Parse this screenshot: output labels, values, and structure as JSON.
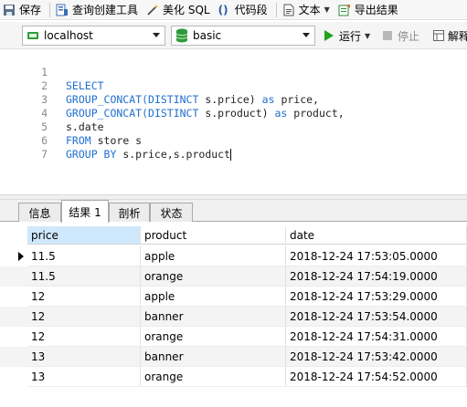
{
  "toolbar": {
    "save": "保存",
    "query_builder": "查询创建工具",
    "beautify": "美化 SQL",
    "snippet": "代码段",
    "text": "文本",
    "export": "导出结果"
  },
  "connection": {
    "server": "localhost",
    "database": "basic",
    "run": "运行",
    "stop": "停止",
    "explain": "解释"
  },
  "editor": {
    "lines": [
      {
        "num": "1",
        "parts": [
          {
            "t": "SELECT",
            "c": "kw"
          }
        ]
      },
      {
        "num": "2",
        "parts": [
          {
            "t": "GROUP_CONCAT(",
            "c": "fn"
          },
          {
            "t": "DISTINCT",
            "c": "kw"
          },
          {
            "t": " s.price) ",
            "c": "id"
          },
          {
            "t": "as",
            "c": "kw"
          },
          {
            "t": " price,",
            "c": "id"
          }
        ]
      },
      {
        "num": "3",
        "parts": [
          {
            "t": "GROUP_CONCAT(",
            "c": "fn"
          },
          {
            "t": "DISTINCT",
            "c": "kw"
          },
          {
            "t": " s.product) ",
            "c": "id"
          },
          {
            "t": "as",
            "c": "kw"
          },
          {
            "t": " product,",
            "c": "id"
          }
        ]
      },
      {
        "num": "4",
        "parts": [
          {
            "t": "s.date",
            "c": "id"
          }
        ]
      },
      {
        "num": "5",
        "parts": [
          {
            "t": "FROM",
            "c": "kw"
          },
          {
            "t": " store s",
            "c": "id"
          }
        ]
      },
      {
        "num": "6",
        "parts": [
          {
            "t": "GROUP BY",
            "c": "kw"
          },
          {
            "t": " s.price,s.product",
            "c": "id"
          }
        ]
      },
      {
        "num": "7",
        "parts": []
      }
    ]
  },
  "tabs": [
    {
      "label": "信息"
    },
    {
      "label": "结果 1"
    },
    {
      "label": "剖析"
    },
    {
      "label": "状态"
    }
  ],
  "result": {
    "columns": [
      "price",
      "product",
      "date"
    ],
    "rows": [
      [
        "11.5",
        "apple",
        "2018-12-24 17:53:05.0000"
      ],
      [
        "11.5",
        "orange",
        "2018-12-24 17:54:19.0000"
      ],
      [
        "12",
        "apple",
        "2018-12-24 17:53:29.0000"
      ],
      [
        "12",
        "banner",
        "2018-12-24 17:53:54.0000"
      ],
      [
        "12",
        "orange",
        "2018-12-24 17:54:31.0000"
      ],
      [
        "13",
        "banner",
        "2018-12-24 17:53:42.0000"
      ],
      [
        "13",
        "orange",
        "2018-12-24 17:54:52.0000"
      ]
    ]
  },
  "colors": {
    "keyword": "#1f6fd0",
    "selected_header": "#cfe8fb",
    "run_green": "#1ea31e"
  }
}
